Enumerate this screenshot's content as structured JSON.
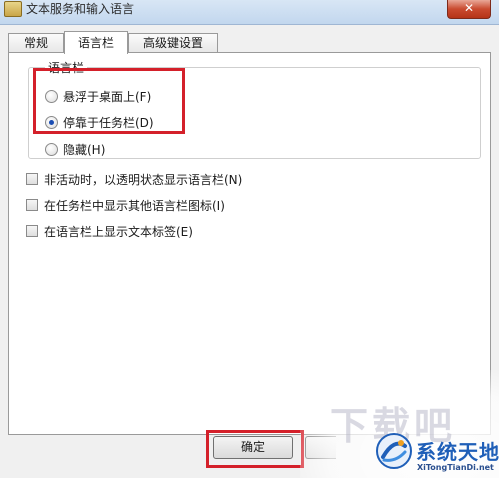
{
  "window": {
    "title": "文本服务和输入语言",
    "close_label": "✕"
  },
  "tabs": [
    {
      "label": "常规",
      "active": false
    },
    {
      "label": "语言栏",
      "active": true
    },
    {
      "label": "高级键设置",
      "active": false
    }
  ],
  "language_bar_group": {
    "title": "语言栏",
    "options": [
      {
        "label": "悬浮于桌面上(F)",
        "selected": false
      },
      {
        "label": "停靠于任务栏(D)",
        "selected": true
      },
      {
        "label": "隐藏(H)",
        "selected": false
      }
    ]
  },
  "checkboxes": [
    {
      "label": "非活动时，以透明状态显示语言栏(N)",
      "checked": false
    },
    {
      "label": "在任务栏中显示其他语言栏图标(I)",
      "checked": false
    },
    {
      "label": "在语言栏上显示文本标签(E)",
      "checked": false
    }
  ],
  "buttons": {
    "ok_label": "确定"
  },
  "highlight_color": "#d4202a",
  "watermark": {
    "ghost_text": "下载吧",
    "brand_cn": "系统天地",
    "brand_en": "XiTongTianDi.net"
  }
}
